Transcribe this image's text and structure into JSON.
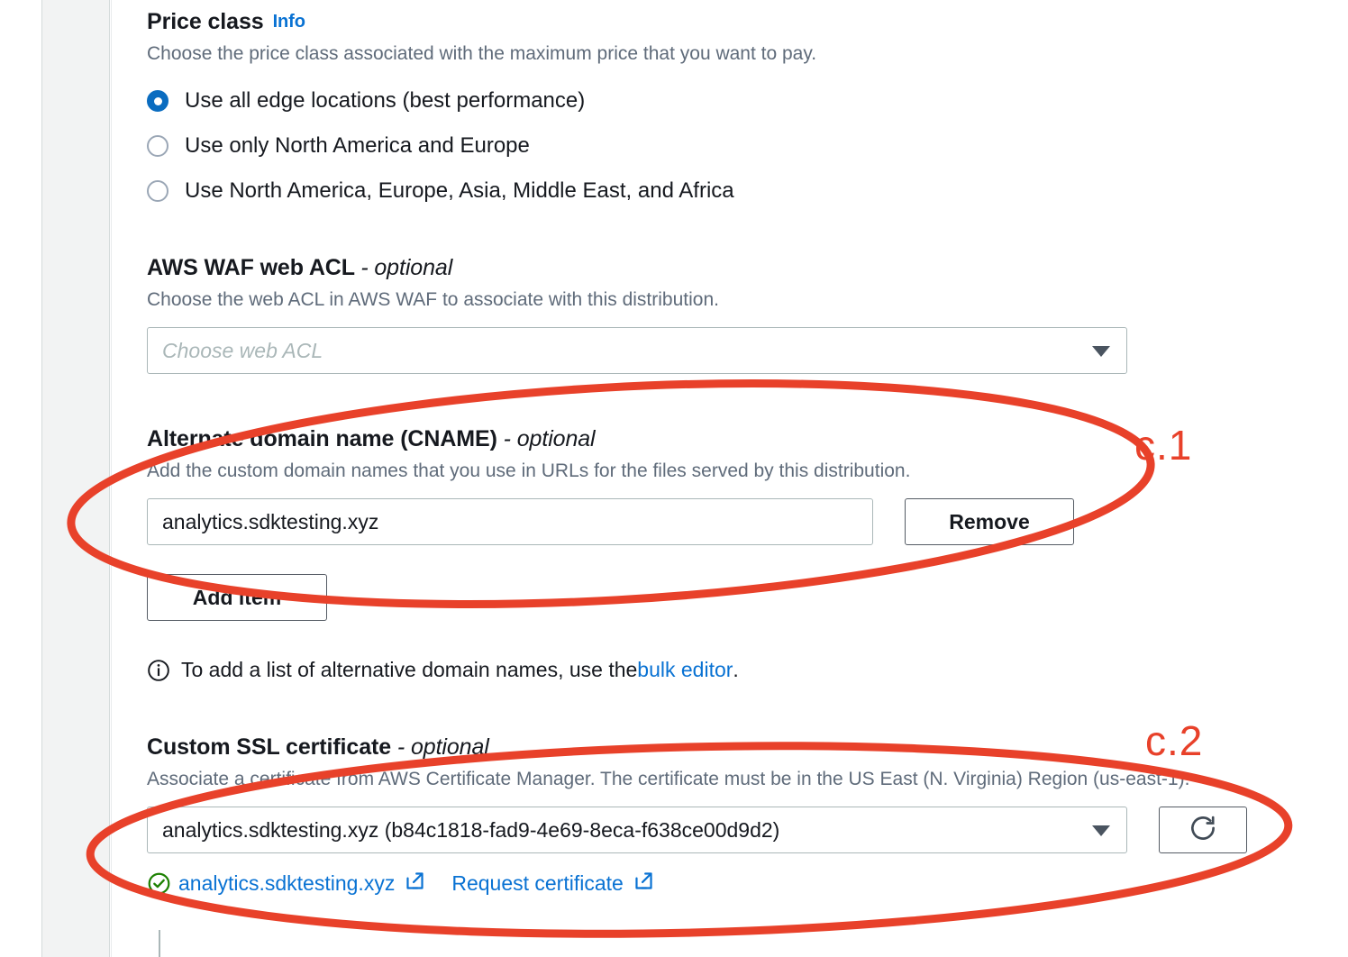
{
  "price_class": {
    "label": "Price class",
    "info_label": "Info",
    "description": "Choose the price class associated with the maximum price that you want to pay.",
    "options": [
      {
        "label": "Use all edge locations (best performance)",
        "selected": true
      },
      {
        "label": "Use only North America and Europe",
        "selected": false
      },
      {
        "label": "Use North America, Europe, Asia, Middle East, and Africa",
        "selected": false
      }
    ]
  },
  "waf": {
    "label": "AWS WAF web ACL",
    "optional_suffix": "- optional",
    "description": "Choose the web ACL in AWS WAF to associate with this distribution.",
    "select_placeholder": "Choose web ACL",
    "caret_icon": "chevron-down-icon"
  },
  "cname": {
    "label": "Alternate domain name (CNAME)",
    "optional_suffix": "- optional",
    "description": "Add the custom domain names that you use in URLs for the files served by this distribution.",
    "value": "analytics.sdktesting.xyz",
    "remove_label": "Remove",
    "add_item_label": "Add item",
    "note_icon": "info-circle-icon",
    "note_prefix": "To add a list of alternative domain names, use the ",
    "note_link": "bulk editor",
    "note_suffix": "."
  },
  "ssl": {
    "label": "Custom SSL certificate",
    "optional_suffix": "- optional",
    "description": "Associate a certificate from AWS Certificate Manager. The certificate must be in the US East (N. Virginia) Region (us-east-1).",
    "selected_certificate": "analytics.sdktesting.xyz (b84c1818-fad9-4e69-8eca-f638ce00d9d2)",
    "caret_icon": "chevron-down-icon",
    "refresh_icon": "refresh-icon",
    "status_icon": "success-check-circle-icon",
    "certificate_link": "analytics.sdktesting.xyz",
    "certificate_link_icon": "external-link-icon",
    "request_certificate_link": "Request certificate",
    "request_certificate_icon": "external-link-icon"
  },
  "annotations": {
    "color": "#e8412a",
    "items": [
      {
        "label": "c.1",
        "target": "alternate-domain-name-section"
      },
      {
        "label": "c.2",
        "target": "custom-ssl-certificate-section"
      }
    ]
  },
  "colors": {
    "accent_link": "#0972d3",
    "radio_selected": "#0a6cc0",
    "status_success": "#1d8102",
    "annotation_red": "#e8412a",
    "rail_background": "#f2f3f3",
    "border": "#aab7b8",
    "text": "#16191f",
    "muted_text": "#5f6b7a"
  }
}
